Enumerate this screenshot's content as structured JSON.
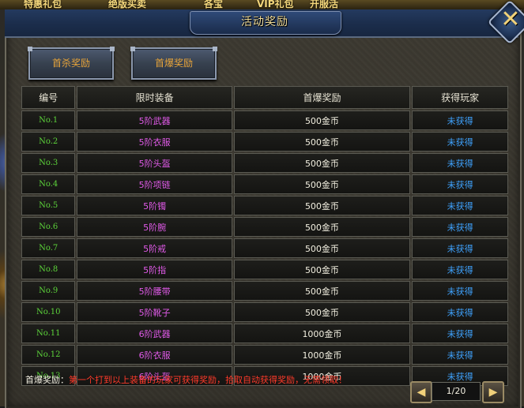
{
  "top_menu": [
    "特惠礼包",
    "绝版买卖",
    "各宝",
    "VIP礼包",
    "开服活"
  ],
  "window": {
    "title": "活动奖励"
  },
  "tabs": [
    {
      "label": "首杀奖励"
    },
    {
      "label": "首爆奖励"
    }
  ],
  "table": {
    "headers": [
      "编号",
      "限时装备",
      "首爆奖励",
      "获得玩家"
    ],
    "rows": [
      {
        "no": "No.1",
        "equip": "5阶武器",
        "reward": "500金币",
        "player": "未获得"
      },
      {
        "no": "No.2",
        "equip": "5阶衣服",
        "reward": "500金币",
        "player": "未获得"
      },
      {
        "no": "No.3",
        "equip": "5阶头盔",
        "reward": "500金币",
        "player": "未获得"
      },
      {
        "no": "No.4",
        "equip": "5阶项链",
        "reward": "500金币",
        "player": "未获得"
      },
      {
        "no": "No.5",
        "equip": "5阶镯",
        "reward": "500金币",
        "player": "未获得"
      },
      {
        "no": "No.6",
        "equip": "5阶腕",
        "reward": "500金币",
        "player": "未获得"
      },
      {
        "no": "No.7",
        "equip": "5阶戒",
        "reward": "500金币",
        "player": "未获得"
      },
      {
        "no": "No.8",
        "equip": "5阶指",
        "reward": "500金币",
        "player": "未获得"
      },
      {
        "no": "No.9",
        "equip": "5阶腰带",
        "reward": "500金币",
        "player": "未获得"
      },
      {
        "no": "No.10",
        "equip": "5阶靴子",
        "reward": "500金币",
        "player": "未获得"
      },
      {
        "no": "No.11",
        "equip": "6阶武器",
        "reward": "1000金币",
        "player": "未获得"
      },
      {
        "no": "No.12",
        "equip": "6阶衣服",
        "reward": "1000金币",
        "player": "未获得"
      },
      {
        "no": "No.13",
        "equip": "6阶头盔",
        "reward": "1000金币",
        "player": "未获得"
      }
    ]
  },
  "footer": {
    "lead": "首爆奖励：",
    "body": "第一个打到以上装备的玩家可获得奖励，拾取自动获得奖励，无需领取！"
  },
  "pager": {
    "prev_icon": "◀",
    "next_icon": "▶",
    "label": "1/20"
  },
  "colors": {
    "number": "#5cd33a",
    "equipment": "#e05ae8",
    "reward": "#f2efe0",
    "player": "#3fa3ff",
    "notice": "#ff3a2a",
    "tab_text": "#e6a33a"
  }
}
